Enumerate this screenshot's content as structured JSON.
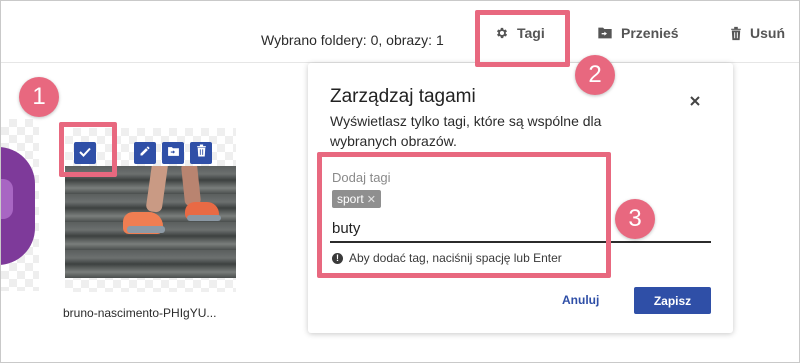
{
  "toolbar": {
    "selection_status": "Wybrano foldery: 0, obrazy: 1",
    "tags_label": "Tagi",
    "move_label": "Przenieś",
    "delete_label": "Usuń"
  },
  "gallery": {
    "selected_image": {
      "filename": "bruno-nascimento-PHIgYU...",
      "checked": true
    }
  },
  "callouts": [
    "1",
    "2",
    "3"
  ],
  "tag_dialog": {
    "title": "Zarządzaj tagami",
    "description": "Wyświetlasz tylko tagi, które są wspólne dla wybranych obrazów.",
    "field_label": "Dodaj tagi",
    "tags": [
      "sport"
    ],
    "chip_remove": "✕",
    "input_value": "buty",
    "hint": "Aby dodać tag, naciśnij spację lub Enter",
    "cancel_label": "Anuluj",
    "save_label": "Zapisz"
  },
  "colors": {
    "accent": "#2f4fa7",
    "highlight": "#e8687f"
  },
  "icons": [
    "gear-icon",
    "folder-move-icon",
    "trash-icon",
    "check-icon",
    "pencil-icon",
    "folder-icon",
    "close-icon",
    "info-icon"
  ]
}
